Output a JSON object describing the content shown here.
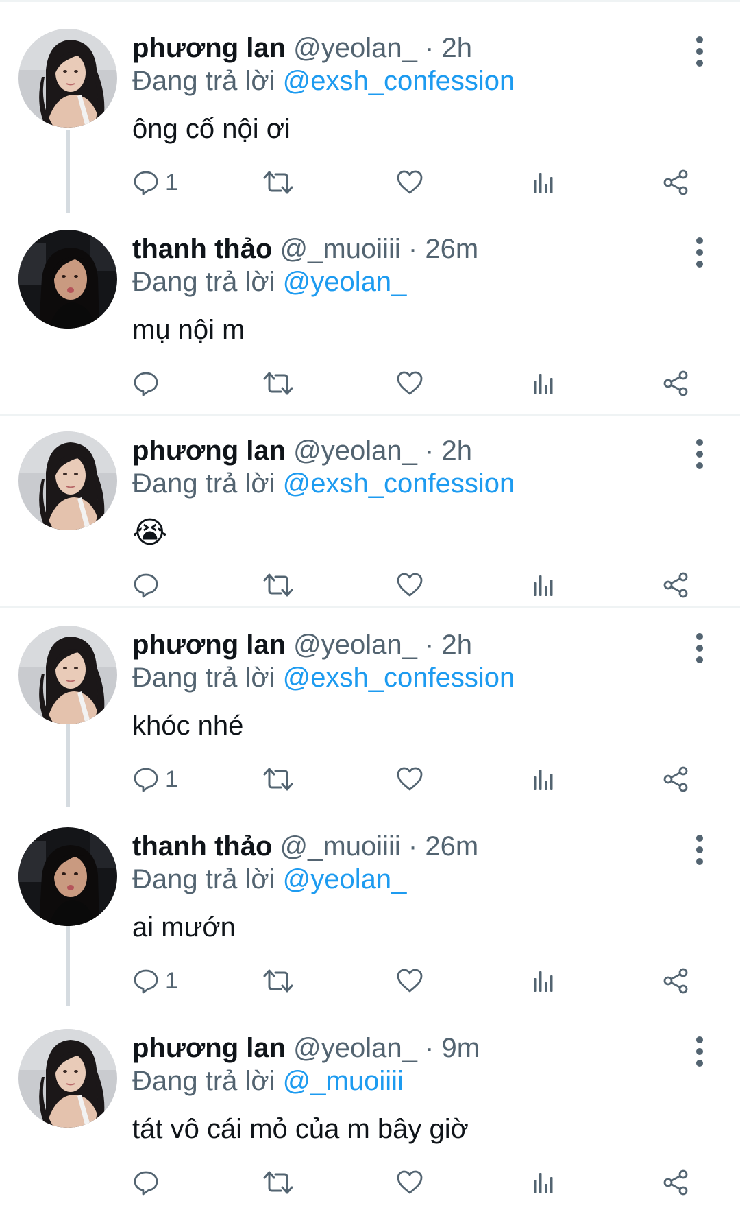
{
  "reply_prefix": "Đang trả lời",
  "tweets": [
    {
      "name": "phương lan",
      "handle": "@yeolan_",
      "separator": "·",
      "time": "2h",
      "reply_to": "@exsh_confession",
      "text": "ông cố nội ơi",
      "reply_count": "1"
    },
    {
      "name": "thanh thảo",
      "handle": "@_muoiiii",
      "separator": "·",
      "time": "26m",
      "reply_to": "@yeolan_",
      "text": "mụ nội m",
      "reply_count": ""
    },
    {
      "name": "phương lan",
      "handle": "@yeolan_",
      "separator": "·",
      "time": "2h",
      "reply_to": "@exsh_confession",
      "text": "😭",
      "reply_count": ""
    },
    {
      "name": "phương lan",
      "handle": "@yeolan_",
      "separator": "·",
      "time": "2h",
      "reply_to": "@exsh_confession",
      "text": "khóc nhé",
      "reply_count": "1"
    },
    {
      "name": "thanh thảo",
      "handle": "@_muoiiii",
      "separator": "·",
      "time": "26m",
      "reply_to": "@yeolan_",
      "text": "ai mướn",
      "reply_count": "1"
    },
    {
      "name": "phương lan",
      "handle": "@yeolan_",
      "separator": "·",
      "time": "9m",
      "reply_to": "@_muoiiii",
      "text": "tát vô cái mỏ của m bây giờ",
      "reply_count": ""
    }
  ],
  "icons": {
    "reply": "speech-bubble-icon",
    "retweet": "retweet-icon",
    "like": "heart-icon",
    "views": "bar-chart-icon",
    "share": "share-icon",
    "more": "vertical-dots-icon"
  },
  "colors": {
    "mention": "#1d9bf0",
    "secondary_text": "#536471",
    "primary_text": "#0f1419",
    "divider": "#eff3f4",
    "thread_line": "#d5dbe0"
  }
}
